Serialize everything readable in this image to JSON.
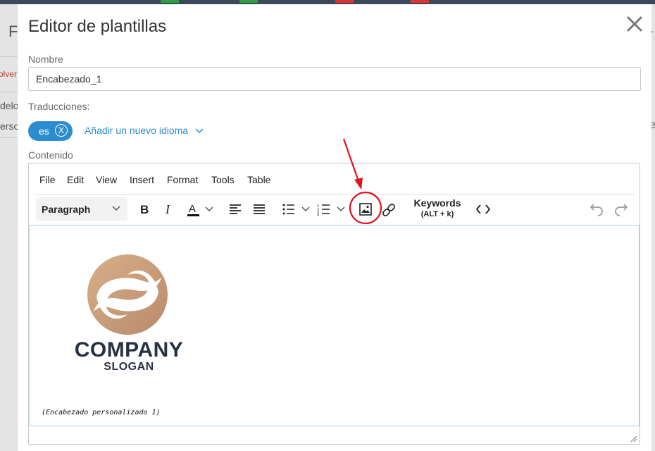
{
  "background": {
    "fragments": [
      "olver",
      "delo",
      "erso"
    ],
    "fragment_right": "r",
    "fragment_right2": "e"
  },
  "modal": {
    "title": "Editor de plantillas",
    "name_label": "Nombre",
    "name_value": "Encabezado_1",
    "translations_label": "Traducciones:",
    "language_tag": "es",
    "language_remove": "X",
    "add_language": "Añadir un nuevo idioma",
    "content_label": "Contenido"
  },
  "editor": {
    "menu": [
      "File",
      "Edit",
      "View",
      "Insert",
      "Format",
      "Tools",
      "Table"
    ],
    "block_format": "Paragraph",
    "keywords_label": "Keywords",
    "keywords_shortcut": "(ALT + k)",
    "logo_company": "COMPANY",
    "logo_slogan": "SLOGAN",
    "caption": "(Encabezado personalizado 1)"
  },
  "colors": {
    "accent": "#2b8dd0",
    "logo_brown": "#c79a76",
    "logo_text": "#273141",
    "annotation_red": "#e0141e"
  }
}
